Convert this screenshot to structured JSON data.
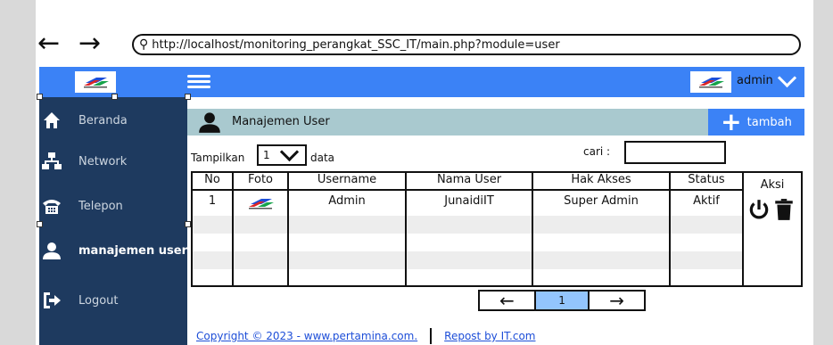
{
  "browser": {
    "url": "http://localhost/monitoring_perangkat_SSC_IT/main.php?module=user",
    "back_icon": "arrow-left-icon",
    "forward_icon": "arrow-right-icon",
    "search_icon": "magnifier-icon"
  },
  "topbar": {
    "user_label": "admin",
    "color": "#3b82f6"
  },
  "sidebar": {
    "items": [
      {
        "label": "Beranda",
        "icon": "home-icon"
      },
      {
        "label": "Network",
        "icon": "network-icon"
      },
      {
        "label": "Telepon",
        "icon": "phone-icon"
      },
      {
        "label": "manajemen user",
        "icon": "user-icon"
      },
      {
        "label": "Logout",
        "icon": "logout-icon"
      }
    ],
    "color": "#1e3a5f"
  },
  "main": {
    "title": "Manajemen User",
    "add_button": "tambah",
    "show_label": "Tampilkan",
    "page_length": "1",
    "data_label": "data",
    "search_label": "cari :",
    "search_value": "",
    "table": {
      "columns": [
        "No",
        "Foto",
        "Username",
        "Nama User",
        "Hak Akses",
        "Status"
      ],
      "actions_header": "Aksi",
      "rows": [
        {
          "no": "1",
          "foto": "pertamina-logo",
          "username": "Admin",
          "nama_user": "JunaidiIT",
          "hak_akses": "Super Admin",
          "status": "Aktif"
        }
      ]
    },
    "pagination": {
      "current_page": "1"
    }
  },
  "footer": {
    "copyright": "Copyright © 2023 - www.pertamina.com.",
    "repost": "Repost by IT.com"
  }
}
